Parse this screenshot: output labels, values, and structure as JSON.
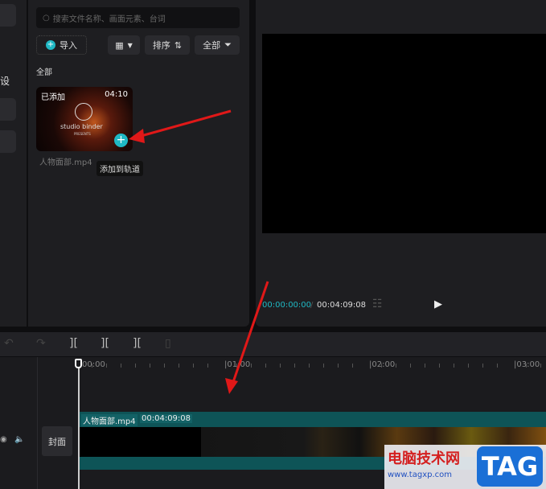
{
  "left_nav": {
    "partial_label": "设"
  },
  "media": {
    "search_placeholder": "搜索文件名称、画面元素、台词",
    "import_label": "导入",
    "sort_label": "排序",
    "filter_label": "全部",
    "section_label": "全部",
    "clip": {
      "badge": "已添加",
      "duration": "04:10",
      "filename": "人物面部.mp4",
      "thumb_text": "studio binder",
      "thumb_sub": "PRESENTS",
      "tooltip": "添加到轨道"
    }
  },
  "preview": {
    "current_time": "00:00:00:00",
    "separator": "/",
    "total_time": "00:04:09:08"
  },
  "timeline": {
    "ruler": [
      "00:00",
      "01:00",
      "02:00",
      "03:00"
    ],
    "cover_label": "封面",
    "track_clip": {
      "name": "人物面部.mp4",
      "duration": "00:04:09:08"
    }
  },
  "watermark": {
    "text": "电脑技术网",
    "url": "www.tagxp.com",
    "logo": "TAG"
  },
  "colors": {
    "accent": "#1fb8c4",
    "clip": "#0e5457",
    "arrow": "#e01818"
  }
}
